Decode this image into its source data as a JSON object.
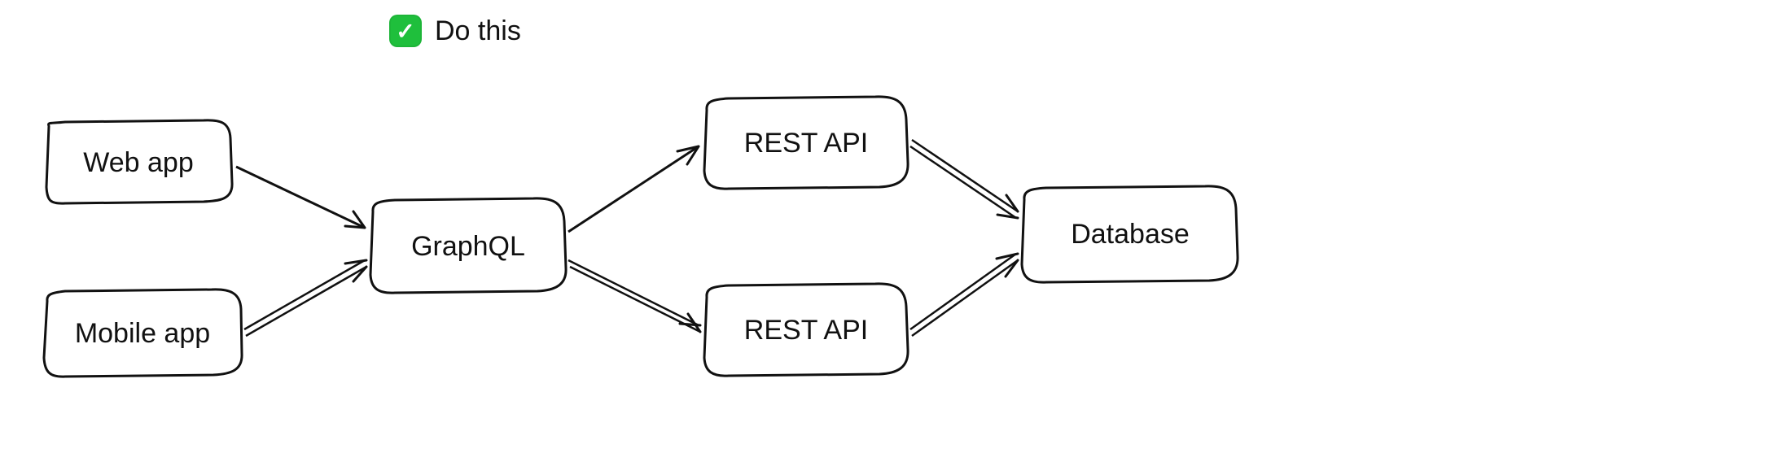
{
  "caption": {
    "text": "Do this",
    "icon_name": "check-icon"
  },
  "nodes": {
    "web_app": {
      "label": "Web app"
    },
    "mobile_app": {
      "label": "Mobile app"
    },
    "graphql": {
      "label": "GraphQL"
    },
    "rest_api_1": {
      "label": "REST API"
    },
    "rest_api_2": {
      "label": "REST API"
    },
    "database": {
      "label": "Database"
    }
  },
  "edges": [
    {
      "from": "web_app",
      "to": "graphql",
      "style": "single"
    },
    {
      "from": "mobile_app",
      "to": "graphql",
      "style": "double"
    },
    {
      "from": "graphql",
      "to": "rest_api_1",
      "style": "single"
    },
    {
      "from": "graphql",
      "to": "rest_api_2",
      "style": "double"
    },
    {
      "from": "rest_api_1",
      "to": "database",
      "style": "double"
    },
    {
      "from": "rest_api_2",
      "to": "database",
      "style": "double"
    }
  ],
  "colors": {
    "stroke": "#111111",
    "background": "#ffffff",
    "accent_green": "#1fbf3c"
  }
}
